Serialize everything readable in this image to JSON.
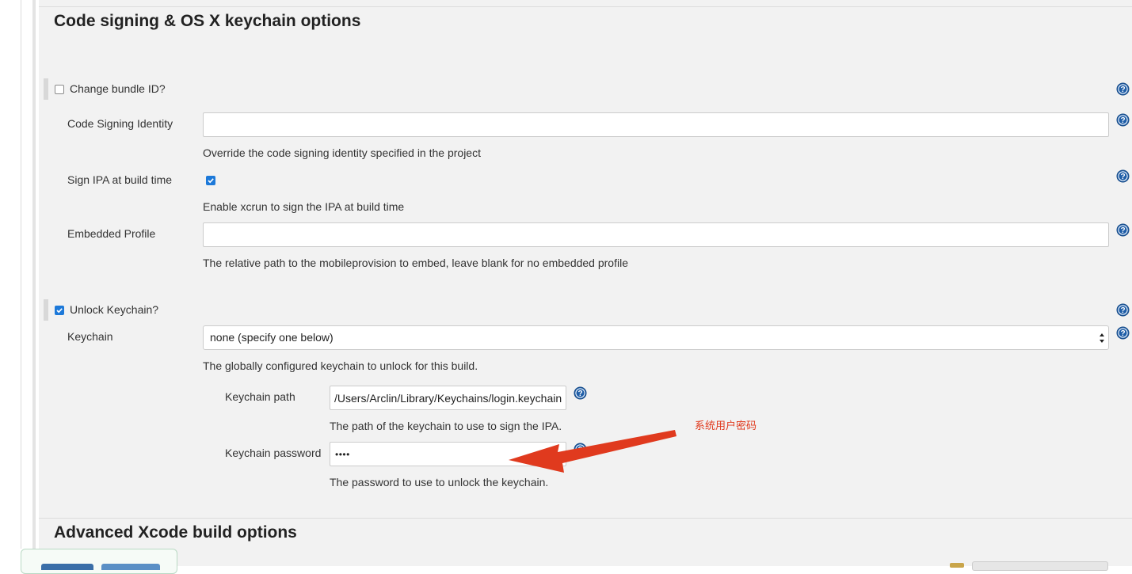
{
  "section_code_signing": {
    "title": "Code signing & OS X keychain options",
    "change_bundle_id": {
      "label": "Change bundle ID?",
      "checked": false
    },
    "code_signing_identity": {
      "label": "Code Signing Identity",
      "value": "",
      "description": "Override the code signing identity specified in the project"
    },
    "sign_ipa": {
      "label": "Sign IPA at build time",
      "checked": true,
      "description": "Enable xcrun to sign the IPA at build time"
    },
    "embedded_profile": {
      "label": "Embedded Profile",
      "value": "",
      "description": "The relative path to the mobileprovision to embed, leave blank for no embedded profile"
    },
    "unlock_keychain": {
      "label": "Unlock Keychain?",
      "checked": true
    },
    "keychain": {
      "label": "Keychain",
      "selected": "none (specify one below)",
      "description": "The globally configured keychain to unlock for this build."
    },
    "keychain_path": {
      "label": "Keychain path",
      "value": "/Users/Arclin/Library/Keychains/login.keychain",
      "description": "The path of the keychain to use to sign the IPA."
    },
    "keychain_password": {
      "label": "Keychain password",
      "value": "••••",
      "description": "The password to use to unlock the keychain."
    }
  },
  "annotation": {
    "text": "系统用户密码",
    "color": "#e03a1e"
  },
  "section_advanced": {
    "title": "Advanced Xcode build options"
  },
  "colors": {
    "help_icon": "#1f5ea8",
    "checkbox_checked": "#1d79d9",
    "panel_background": "#f2f2f2"
  }
}
